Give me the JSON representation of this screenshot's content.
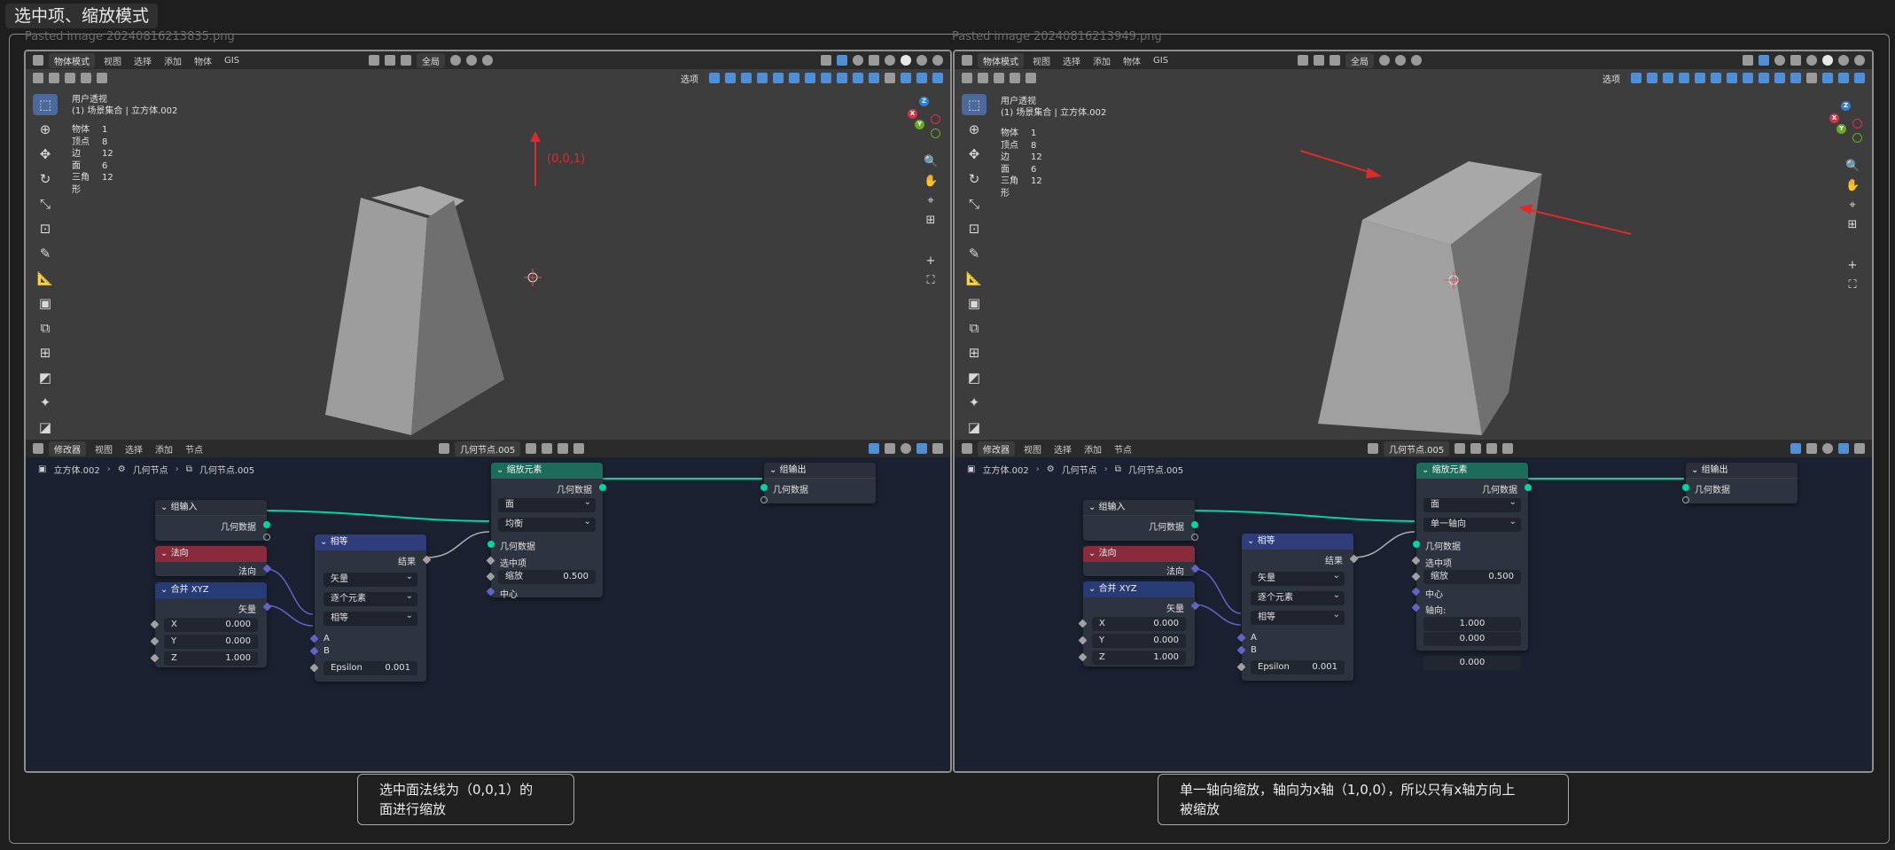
{
  "page": {
    "title": "选中项、缩放模式"
  },
  "left": {
    "caption": "Pasted image 20240816213835.png",
    "viewport": {
      "mode": "物体模式",
      "menus": [
        "视图",
        "选择",
        "添加",
        "物体",
        "GIS"
      ],
      "transform": "全局",
      "select_mode": "选项",
      "view_name": "用户透视",
      "collection": "(1) 场景集合 | 立方体.002",
      "stats": [
        {
          "k": "物体",
          "v": "1"
        },
        {
          "k": "顶点",
          "v": "8"
        },
        {
          "k": "边",
          "v": "12"
        },
        {
          "k": "面",
          "v": "6"
        },
        {
          "k": "三角形",
          "v": "12"
        }
      ],
      "annotation": "(0,0,1)"
    },
    "editor": {
      "type": "修改器",
      "menus": [
        "视图",
        "选择",
        "添加",
        "节点"
      ],
      "tree_name": "几何节点.005",
      "breadcrumb": [
        "立方体.002",
        "几何节点",
        "几何节点.005"
      ]
    },
    "nodes": {
      "group_input": {
        "title": "组输入",
        "out": "几何数据"
      },
      "normal": {
        "title": "法向",
        "out": "法向"
      },
      "combine_xyz": {
        "title": "合并 XYZ",
        "out": "矢量",
        "x_label": "X",
        "x": "0.000",
        "y_label": "Y",
        "y": "0.000",
        "z_label": "Z",
        "z": "1.000"
      },
      "compare": {
        "title": "相等",
        "out": "结果",
        "opt1": "矢量",
        "opt2": "逐个元素",
        "opt3": "相等",
        "a": "A",
        "b": "B",
        "eps_label": "Epsilon",
        "eps": "0.001"
      },
      "scale": {
        "title": "缩放元素",
        "out": "几何数据",
        "domain": "面",
        "mode": "均衡",
        "in_geo": "几何数据",
        "selection": "选中项",
        "scale_label": "缩放",
        "scale": "0.500",
        "center": "中心"
      },
      "group_output": {
        "title": "组输出",
        "in": "几何数据"
      }
    },
    "note": [
      "选中面法线为（0,0,1）的",
      "面进行缩放"
    ]
  },
  "right": {
    "caption": "Pasted image 20240816213949.png",
    "viewport": {
      "mode": "物体模式",
      "menus": [
        "视图",
        "选择",
        "添加",
        "物体",
        "GIS"
      ],
      "transform": "全局",
      "select_mode": "选项",
      "view_name": "用户透视",
      "collection": "(1) 场景集合 | 立方体.002",
      "stats": [
        {
          "k": "物体",
          "v": "1"
        },
        {
          "k": "顶点",
          "v": "8"
        },
        {
          "k": "边",
          "v": "12"
        },
        {
          "k": "面",
          "v": "6"
        },
        {
          "k": "三角形",
          "v": "12"
        }
      ]
    },
    "editor": {
      "type": "修改器",
      "menus": [
        "视图",
        "选择",
        "添加",
        "节点"
      ],
      "tree_name": "几何节点.005",
      "breadcrumb": [
        "立方体.002",
        "几何节点",
        "几何节点.005"
      ]
    },
    "nodes": {
      "group_input": {
        "title": "组输入",
        "out": "几何数据"
      },
      "normal": {
        "title": "法向",
        "out": "法向"
      },
      "combine_xyz": {
        "title": "合并 XYZ",
        "out": "矢量",
        "x_label": "X",
        "x": "0.000",
        "y_label": "Y",
        "y": "0.000",
        "z_label": "Z",
        "z": "1.000"
      },
      "compare": {
        "title": "相等",
        "out": "结果",
        "opt1": "矢量",
        "opt2": "逐个元素",
        "opt3": "相等",
        "a": "A",
        "b": "B",
        "eps_label": "Epsilon",
        "eps": "0.001"
      },
      "scale": {
        "title": "缩放元素",
        "out": "几何数据",
        "domain": "面",
        "mode": "单一轴向",
        "in_geo": "几何数据",
        "selection": "选中项",
        "scale_label": "缩放",
        "scale": "0.500",
        "center": "中心",
        "axis_label": "轴向:",
        "ax": "1.000",
        "ay": "0.000",
        "az": "0.000"
      },
      "group_output": {
        "title": "组输出",
        "in": "几何数据"
      }
    },
    "note": [
      "单一轴向缩放，轴向为x轴（1,0,0），所以只有x轴方向上",
      "被缩放"
    ]
  },
  "colors": {
    "geometry_link": "#00d6a3",
    "vector_link": "#6363c7",
    "gray_link": "#b0b0b0",
    "arrow": "#e02a2a"
  }
}
